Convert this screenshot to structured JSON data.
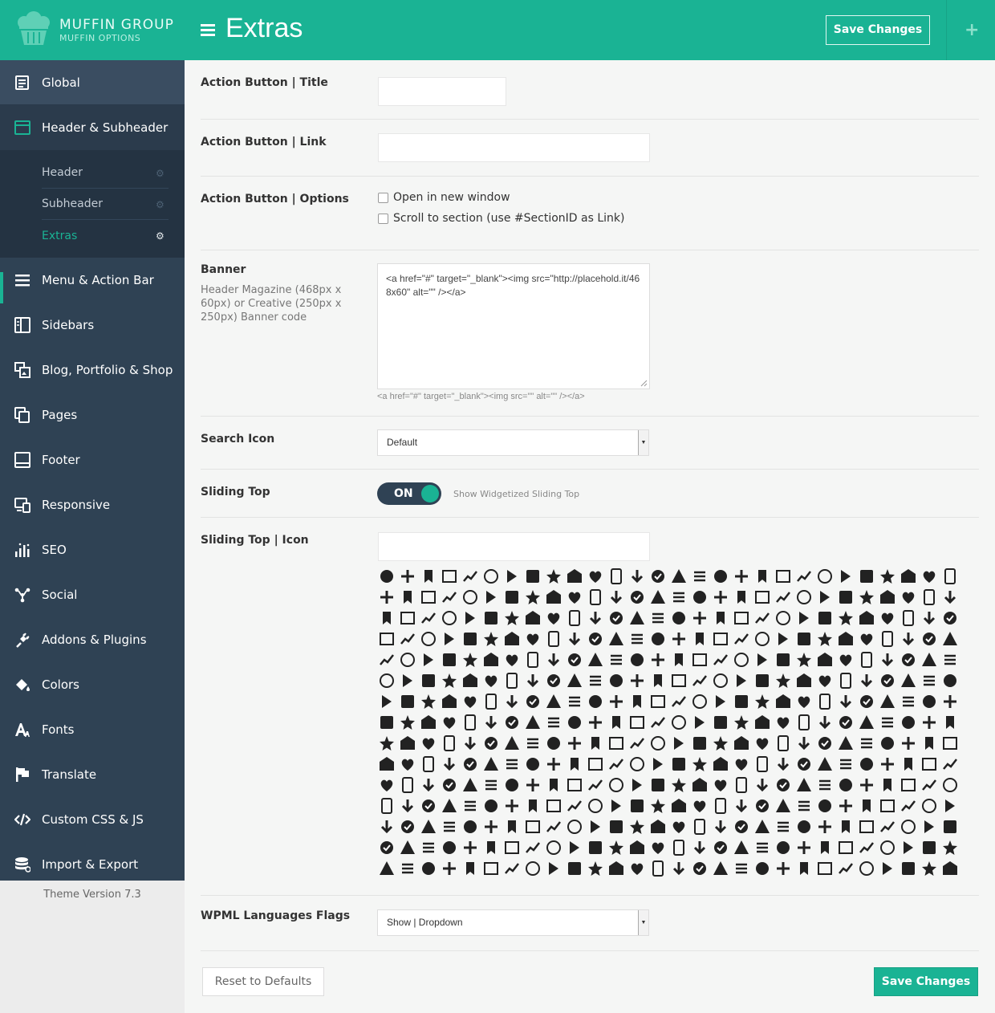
{
  "brand": {
    "name": "MUFFIN GROUP",
    "sub": "MUFFIN OPTIONS"
  },
  "header": {
    "title": "Extras",
    "save_label": "Save Changes",
    "plus": "+"
  },
  "sidebar": {
    "items": [
      {
        "label": "Global",
        "icon": "document-icon"
      },
      {
        "label": "Header & Subheader",
        "icon": "window-icon"
      },
      {
        "label": "Menu & Action Bar",
        "icon": "bars-icon"
      },
      {
        "label": "Sidebars",
        "icon": "columns-icon"
      },
      {
        "label": "Blog, Portfolio & Shop",
        "icon": "gallery-icon"
      },
      {
        "label": "Pages",
        "icon": "pages-icon"
      },
      {
        "label": "Footer",
        "icon": "footer-icon"
      },
      {
        "label": "Responsive",
        "icon": "devices-icon"
      },
      {
        "label": "SEO",
        "icon": "bar-chart-icon"
      },
      {
        "label": "Social",
        "icon": "share-icon"
      },
      {
        "label": "Addons & Plugins",
        "icon": "plug-icon"
      },
      {
        "label": "Colors",
        "icon": "paint-bucket-icon"
      },
      {
        "label": "Fonts",
        "icon": "font-icon"
      },
      {
        "label": "Translate",
        "icon": "flag-icon"
      },
      {
        "label": "Custom CSS & JS",
        "icon": "code-icon"
      },
      {
        "label": "Import & Export",
        "icon": "database-icon"
      }
    ],
    "sub_items": [
      {
        "label": "Header"
      },
      {
        "label": "Subheader"
      },
      {
        "label": "Extras"
      }
    ],
    "version": "Theme Version 7.3"
  },
  "fields": {
    "action_title": {
      "label": "Action Button | Title",
      "value": ""
    },
    "action_link": {
      "label": "Action Button | Link",
      "value": ""
    },
    "action_options": {
      "label": "Action Button | Options",
      "opt1": "Open in new window",
      "opt2": "Scroll to section (use #SectionID as Link)"
    },
    "banner": {
      "label": "Banner",
      "desc": "Header Magazine (468px x 60px) or Creative (250px x 250px) Banner code",
      "value": "<a href=\"#\" target=\"_blank\"><img src=\"http://placehold.it/468x60\" alt=\"\" /></a>",
      "hint": "<a href=\"#\" target=\"_blank\"><img src=\"\" alt=\"\" /></a>"
    },
    "search_icon": {
      "label": "Search Icon",
      "value": "Default"
    },
    "sliding_top": {
      "label": "Sliding Top",
      "toggle": "ON",
      "desc": "Show Widgetized Sliding Top"
    },
    "sliding_top_icon": {
      "label": "Sliding Top | Icon",
      "value": "",
      "icon_count": 448
    },
    "wpml": {
      "label": "WPML Languages Flags",
      "value": "Show | Dropdown"
    }
  },
  "footer": {
    "reset_label": "Reset to Defaults",
    "save_label": "Save Changes"
  },
  "colors": {
    "accent": "#1ab394",
    "nav_bg": "#2f4254",
    "sub_bg": "#243342"
  }
}
